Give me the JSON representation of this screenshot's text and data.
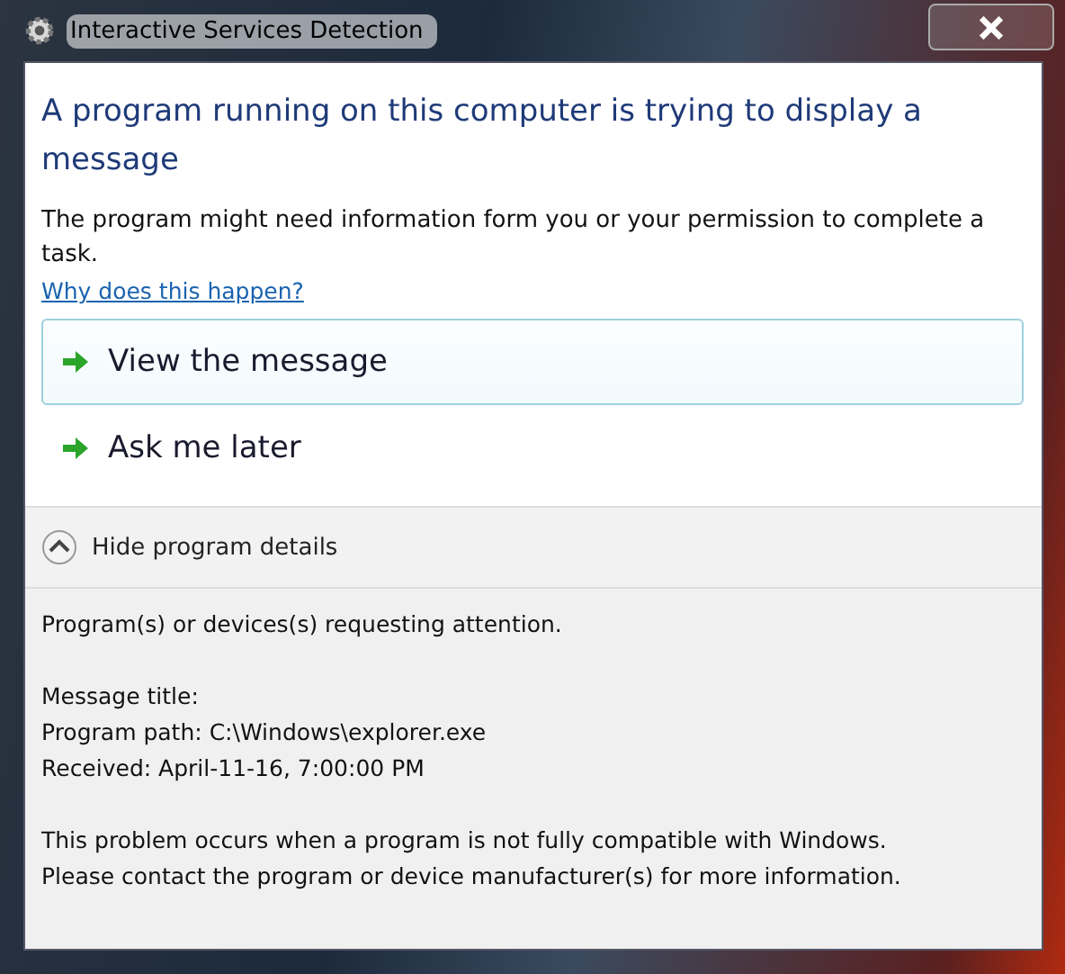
{
  "window": {
    "title": "Interactive Services Detection"
  },
  "heading": "A program running on this computer is trying to display a message",
  "description": "The program might need information form you or your permission to complete a task.",
  "help_link": "Why does this happen?",
  "options": [
    {
      "label": "View the message",
      "selected": true
    },
    {
      "label": "Ask me later",
      "selected": false
    }
  ],
  "details_toggle": {
    "label": "Hide program details",
    "expanded": true
  },
  "details": {
    "paragraphs": [
      [
        "Program(s) or devices(s) requesting attention."
      ],
      [
        "Message title:",
        "Program path:  C:\\Windows\\explorer.exe",
        "Received:  April-11-16, 7:00:00 PM"
      ],
      [
        "This problem occurs when a program is not fully compatible with Windows.",
        "Please contact the program or device manufacturer(s) for more information."
      ]
    ]
  }
}
